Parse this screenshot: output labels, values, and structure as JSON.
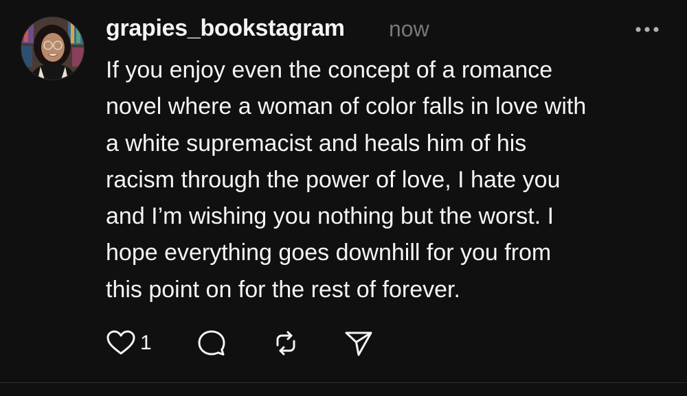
{
  "post": {
    "username": "grapies_bookstagram",
    "timestamp": "now",
    "more_icon": "ellipsis-horizontal",
    "text_lines": [
      "If you enjoy even the concept of a romance",
      "novel where a woman of color falls in love with",
      "a white supremacist and heals him of his",
      "racism through the power of love, I hate you",
      "and I’m wishing you nothing but the worst. I",
      "hope everything goes downhill for you from",
      "this point on for the rest of forever."
    ],
    "actions": {
      "like_icon": "heart-outline",
      "like_count": "1",
      "reply_icon": "speech-bubble-outline",
      "repost_icon": "repost-arrows",
      "share_icon": "paper-plane-outline"
    }
  },
  "colors": {
    "background": "#101010",
    "primary_text": "#f3f5f7",
    "secondary_text": "#777777",
    "divider": "#2e2e2e"
  }
}
